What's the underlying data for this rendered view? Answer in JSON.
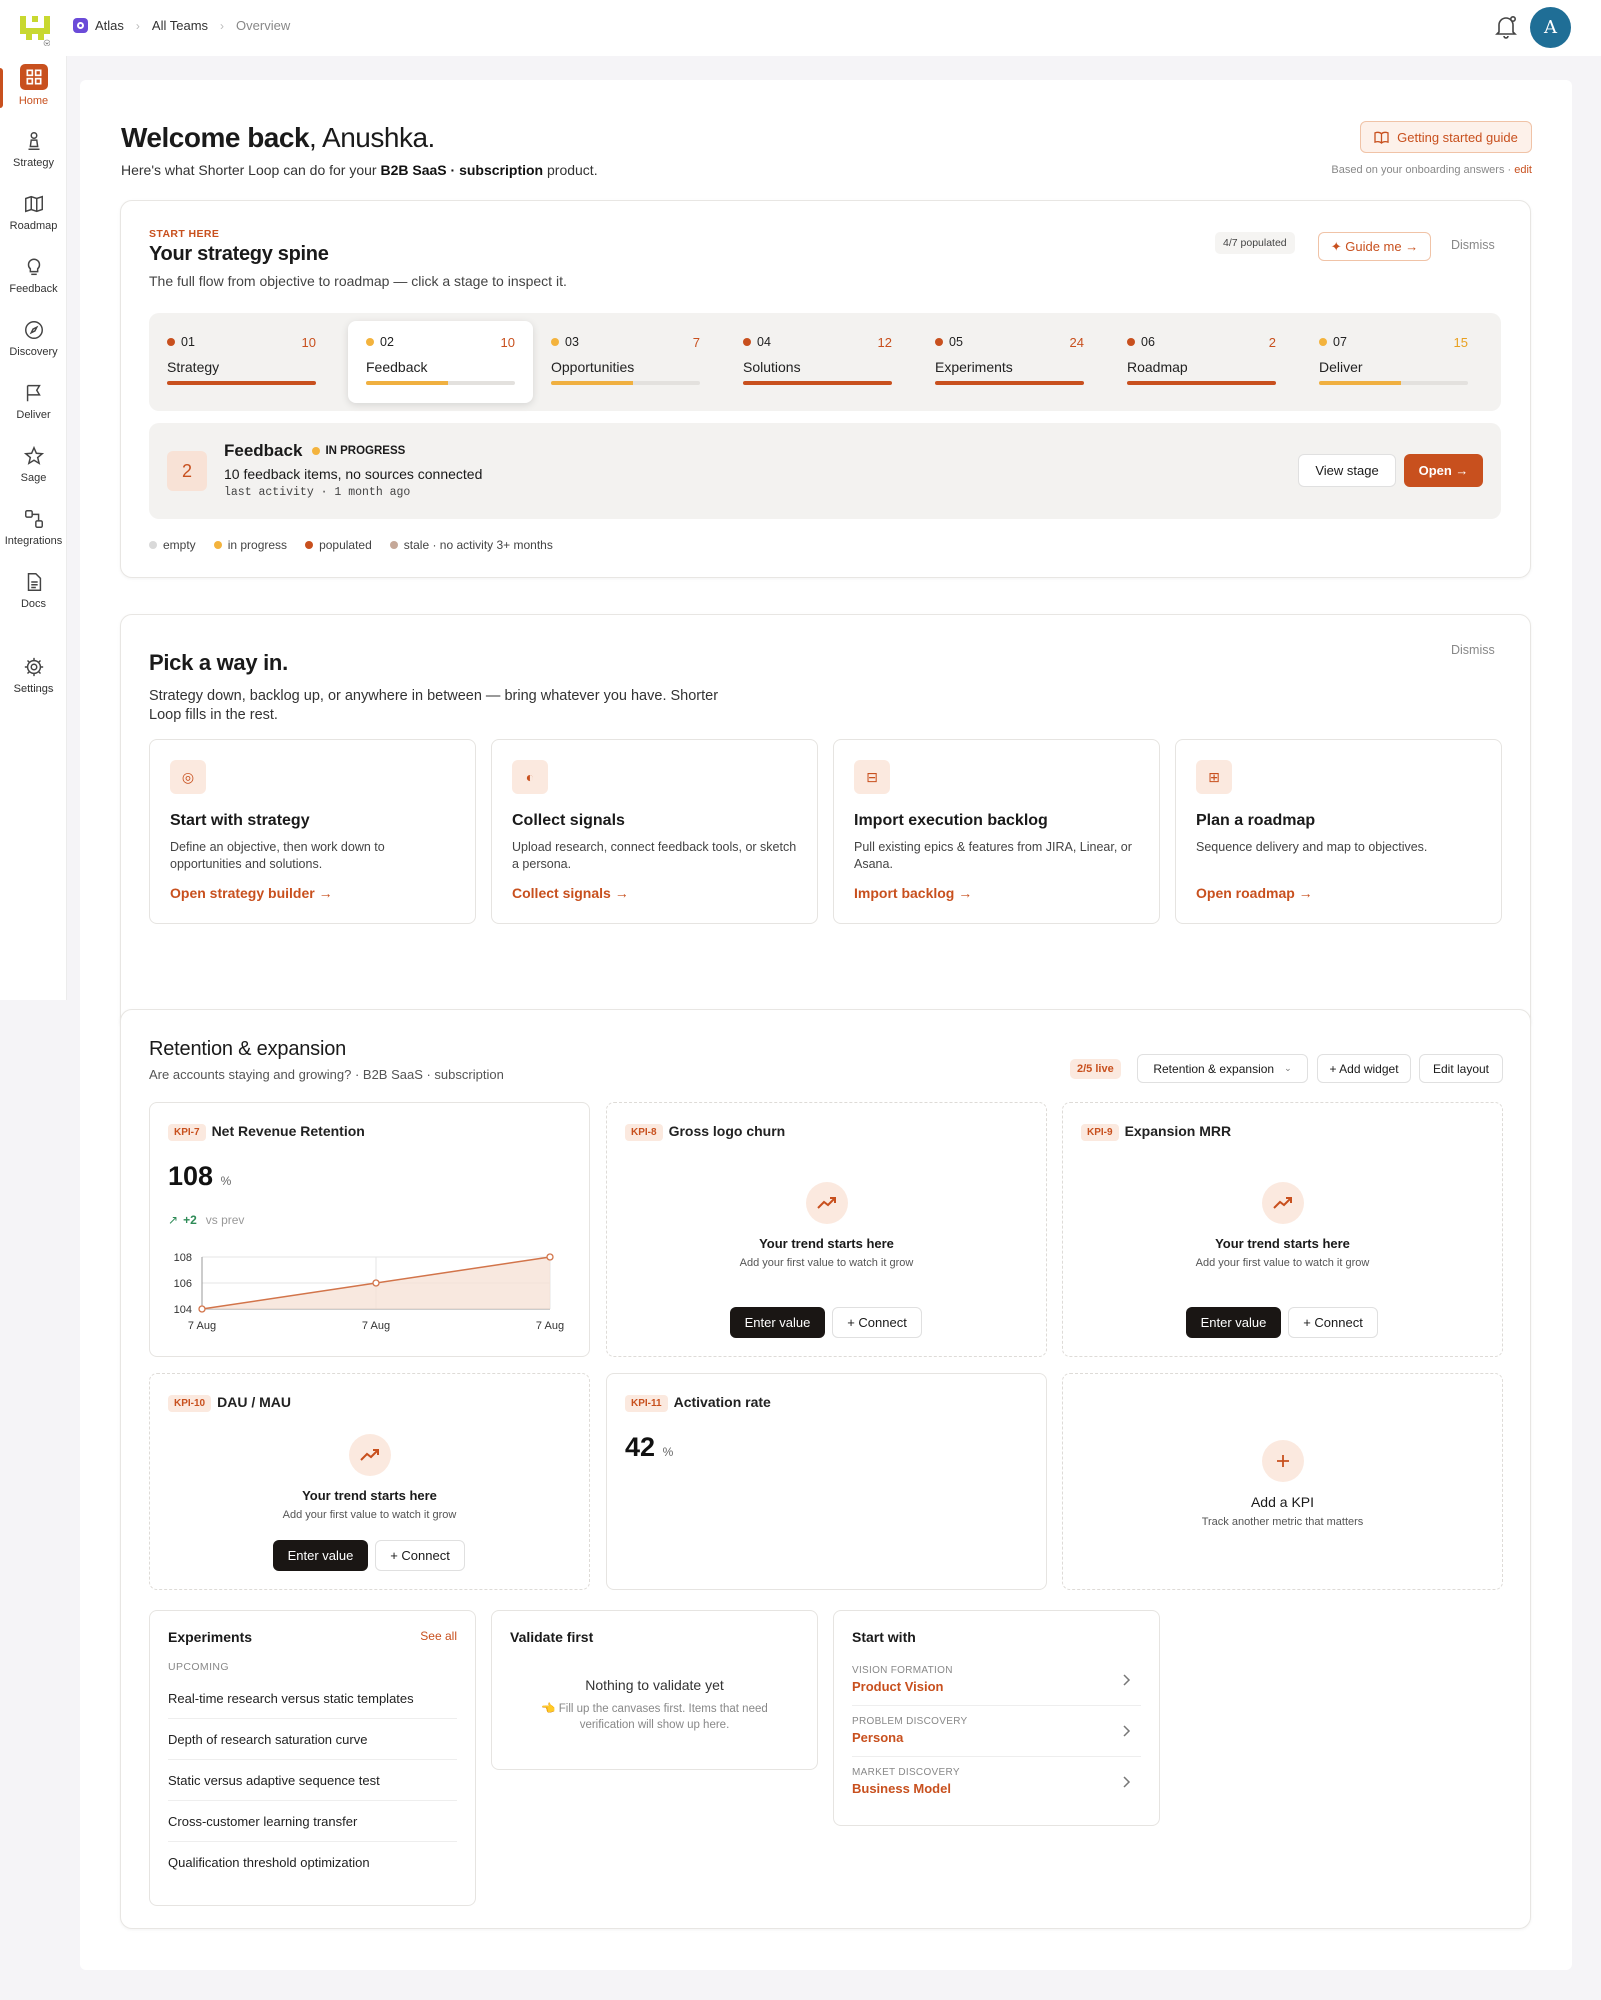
{
  "breadcrumb": {
    "workspace": "Atlas",
    "team": "All Teams",
    "page": "Overview"
  },
  "user": {
    "initial": "A"
  },
  "sidebar": [
    {
      "label": "Home",
      "icon": "grid-icon"
    },
    {
      "label": "Strategy",
      "icon": "chess-pawn-icon"
    },
    {
      "label": "Roadmap",
      "icon": "map-icon"
    },
    {
      "label": "Feedback",
      "icon": "lightbulb-icon"
    },
    {
      "label": "Discovery",
      "icon": "compass-icon"
    },
    {
      "label": "Deliver",
      "icon": "flag-icon"
    },
    {
      "label": "Sage",
      "icon": "star-icon"
    },
    {
      "label": "Integrations",
      "icon": "integrations-icon"
    },
    {
      "label": "Docs",
      "icon": "document-icon"
    },
    {
      "label": "Settings",
      "icon": "gear-icon"
    }
  ],
  "welcome": {
    "title_bold": "Welcome back",
    "title_name": ", Anushka.",
    "sub_pre": "Here's what Shorter Loop can do for your ",
    "sub_b1": "B2B SaaS",
    "sub_dot": " · ",
    "sub_b2": "subscription",
    "sub_post": " product.",
    "guide_button": "Getting started guide",
    "onboarding_note": "Based on your onboarding answers · ",
    "edit_link": "edit"
  },
  "spine": {
    "kicker": "START HERE",
    "title": "Your strategy spine",
    "subtitle": "The full flow from objective to roadmap — click a stage to inspect it.",
    "populated": "4/7 populated",
    "guide_me": "✦ Guide me →",
    "dismiss": "Dismiss",
    "stages": [
      {
        "num": "01",
        "label": "Strategy",
        "count": "10",
        "status": "populated",
        "progress": 1.0
      },
      {
        "num": "02",
        "label": "Feedback",
        "count": "10",
        "status": "in progress",
        "progress": 0.55
      },
      {
        "num": "03",
        "label": "Opportunities",
        "count": "7",
        "status": "in progress",
        "progress": 0.55
      },
      {
        "num": "04",
        "label": "Solutions",
        "count": "12",
        "status": "populated",
        "progress": 1.0
      },
      {
        "num": "05",
        "label": "Experiments",
        "count": "24",
        "status": "populated",
        "progress": 1.0
      },
      {
        "num": "06",
        "label": "Roadmap",
        "count": "2",
        "status": "populated",
        "progress": 1.0
      },
      {
        "num": "07",
        "label": "Deliver",
        "count": "15",
        "status": "in progress",
        "progress": 0.55
      }
    ],
    "detail": {
      "number": "2",
      "title": "Feedback",
      "status": "IN PROGRESS",
      "summary": "10 feedback items, no sources connected",
      "activity": "last activity · 1 month ago",
      "view_button": "View stage",
      "open_button": "Open →"
    },
    "legend": [
      "empty",
      "in progress",
      "populated",
      "stale · no activity 3+ months"
    ]
  },
  "pick": {
    "title": "Pick a way in.",
    "desc_line1": "Strategy down, backlog up, or anywhere in between — bring whatever you have. Shorter",
    "desc_line2": "Loop fills in the rest.",
    "dismiss": "Dismiss",
    "cards": [
      {
        "icon": "◎",
        "title": "Start with strategy",
        "desc": "Define an objective, then work down to opportunities and solutions.",
        "link": "Open strategy builder →"
      },
      {
        "icon": "◐",
        "title": "Collect signals",
        "desc": "Upload research, connect feedback tools, or sketch a persona.",
        "link": "Collect signals →"
      },
      {
        "icon": "⊟",
        "title": "Import execution backlog",
        "desc": "Pull existing epics & features from JIRA, Linear, or Asana.",
        "link": "Import backlog →"
      },
      {
        "icon": "⊞",
        "title": "Plan a roadmap",
        "desc": "Sequence delivery and map to objectives.",
        "link": "Open roadmap →"
      }
    ]
  },
  "retention": {
    "title": "Retention & expansion",
    "subtitle": "Are accounts staying and growing? · B2B SaaS · subscription",
    "live": "2/5 live",
    "dropdown": "Retention & expansion",
    "add_widget": "+ Add widget",
    "edit_layout": "Edit layout",
    "kpis": [
      {
        "tag": "KPI-7",
        "name": "Net Revenue Retention",
        "value": "108",
        "unit": "%",
        "delta": "+2",
        "delta_label": "vs prev"
      },
      {
        "tag": "KPI-8",
        "name": "Gross logo churn"
      },
      {
        "tag": "KPI-9",
        "name": "Expansion MRR"
      },
      {
        "tag": "KPI-10",
        "name": "DAU / MAU"
      },
      {
        "tag": "KPI-11",
        "name": "Activation rate",
        "value": "42",
        "unit": "%"
      }
    ],
    "empty_title": "Your trend starts here",
    "empty_sub": "Add your first value to watch it grow",
    "enter_value": "Enter value",
    "connect": "+ Connect",
    "add_kpi": {
      "title": "Add a KPI",
      "sub": "Track another metric that matters"
    }
  },
  "chart_data": {
    "type": "line",
    "x": [
      "7 Aug",
      "7 Aug",
      "7 Aug"
    ],
    "values": [
      104,
      106,
      108
    ],
    "yticks": [
      "108",
      "106",
      "104"
    ],
    "ylim": [
      104,
      108
    ],
    "accent": "#d2744a"
  },
  "experiments": {
    "title": "Experiments",
    "see_all": "See all",
    "section": "UPCOMING",
    "items": [
      "Real-time research versus static templates",
      "Depth of research saturation curve",
      "Static versus adaptive sequence test",
      "Cross-customer learning transfer",
      "Qualification threshold optimization"
    ]
  },
  "validate": {
    "title": "Validate first",
    "empty": "Nothing to validate yet",
    "hint_line1": "👈 Fill up the canvases first. Items that need",
    "hint_line2": "verification will show up here."
  },
  "start_with": {
    "title": "Start with",
    "items": [
      {
        "kicker": "VISION FORMATION",
        "name": "Product Vision"
      },
      {
        "kicker": "PROBLEM DISCOVERY",
        "name": "Persona"
      },
      {
        "kicker": "MARKET DISCOVERY",
        "name": "Business Model"
      }
    ]
  },
  "colors": {
    "accent": "#c8501e",
    "progress": "#f3b33d",
    "empty": "#d9d9d9",
    "stale": "#c5a898"
  }
}
